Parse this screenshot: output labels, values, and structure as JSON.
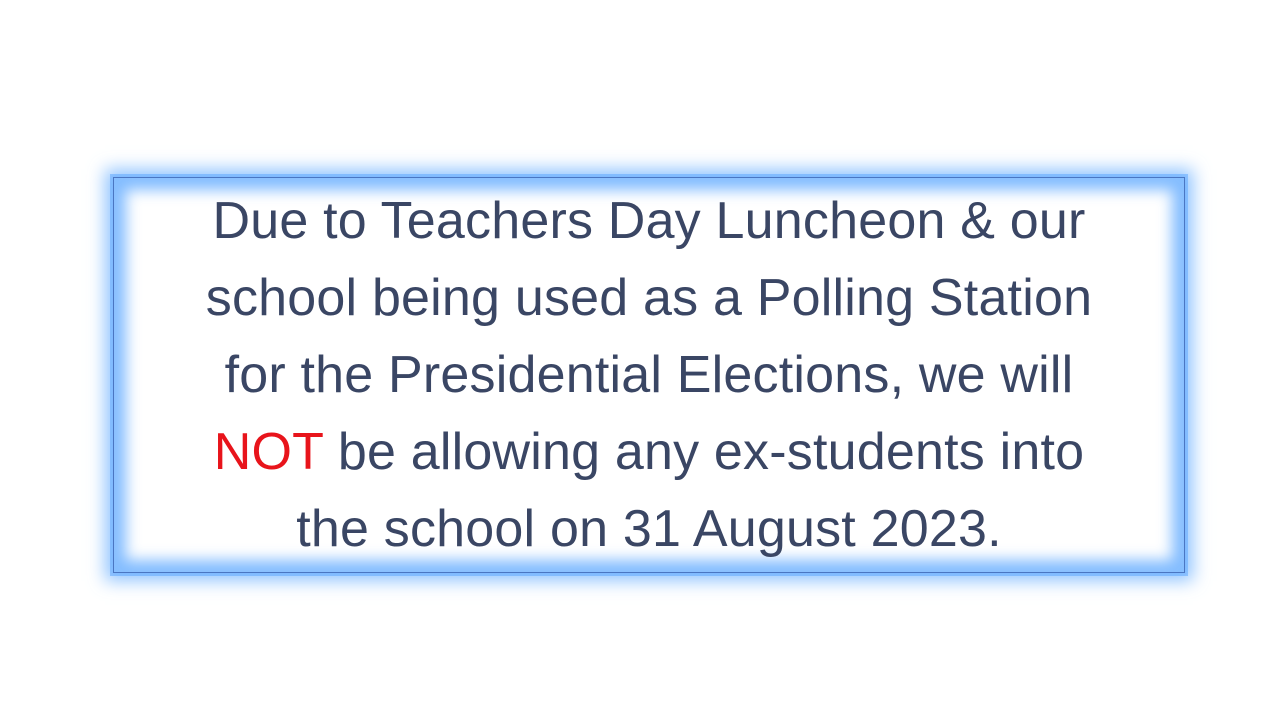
{
  "notice": {
    "line1": "Due to Teachers Day Luncheon & our",
    "line2": "school being used as a Polling Station",
    "line3": "for the Presidential Elections, we will",
    "line4_emphasis": "NOT",
    "line4_rest": " be allowing any ex-students into",
    "line5": "the school on 31 August 2023."
  },
  "colors": {
    "text": "#3a4664",
    "emphasis": "#e8141b",
    "glow": "#6eb2ff",
    "border": "#4a76c2"
  }
}
